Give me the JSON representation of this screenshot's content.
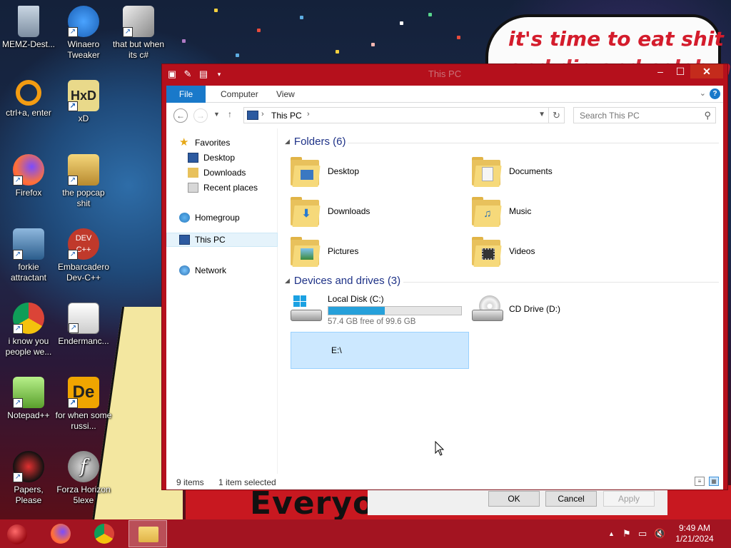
{
  "desktop": {
    "wallpaper_text": "it's time to eat shit",
    "wallpaper_text2": "and die and celebrate",
    "wallpaper_bottom": "Everyo",
    "icons": [
      {
        "label": "MEMZ-Dest...",
        "icon": "recycle-bin-icon"
      },
      {
        "label": "Winaero Tweaker",
        "icon": "winaero-icon"
      },
      {
        "label": "that but when its c#",
        "icon": "stacked-windows-icon"
      },
      {
        "label": "ctrl+a, enter",
        "icon": "ring-icon"
      },
      {
        "label": "xD",
        "icon": "hxd-icon"
      },
      {
        "label": "Firefox",
        "icon": "firefox-icon"
      },
      {
        "label": "the popcap shit",
        "icon": "popcap-icon"
      },
      {
        "label": "forkie attractant",
        "icon": "gears-icon"
      },
      {
        "label": "Embarcadero Dev-C++",
        "icon": "devcpp-icon"
      },
      {
        "label": "i know you people we...",
        "icon": "chrome-icon"
      },
      {
        "label": "Endermanc...",
        "icon": "app-window-icon"
      },
      {
        "label": "Notepad++",
        "icon": "notepadpp-icon"
      },
      {
        "label": "for when some russi...",
        "icon": "de-icon"
      },
      {
        "label": "Papers, Please",
        "icon": "papers-please-icon"
      },
      {
        "label": "Forza Horizon 5lexe",
        "icon": "flash-icon"
      }
    ]
  },
  "behind_dialog": {
    "ok": "OK",
    "cancel": "Cancel",
    "apply": "Apply"
  },
  "window": {
    "title": "This PC",
    "ribbon_tabs": [
      "File",
      "Computer",
      "View"
    ],
    "address": {
      "crumb": "This PC"
    },
    "search": {
      "placeholder": "Search This PC"
    },
    "nav": {
      "favorites": "Favorites",
      "desktop": "Desktop",
      "downloads": "Downloads",
      "recent": "Recent places",
      "homegroup": "Homegroup",
      "this_pc": "This PC",
      "network": "Network"
    },
    "folders_header": "Folders (6)",
    "folders": [
      "Desktop",
      "Documents",
      "Downloads",
      "Music",
      "Pictures",
      "Videos"
    ],
    "drives_header": "Devices and drives (3)",
    "drives": {
      "c": {
        "name": "Local Disk (C:)",
        "free": "57.4 GB free of 99.6 GB",
        "used_fraction": 0.424
      },
      "d": {
        "name": "CD Drive (D:)"
      },
      "e": {
        "name": "E:\\"
      }
    },
    "status": {
      "items": "9 items",
      "selected": "1 item selected"
    }
  },
  "taskbar": {
    "apps": [
      "start-orb-icon",
      "firefox-icon",
      "chrome-icon",
      "file-explorer-icon"
    ],
    "time": "9:49 AM",
    "date": "1/21/2024"
  },
  "colors": {
    "window_frame": "#b5101c",
    "accent": "#1979ca",
    "taskbar": "#a31421"
  }
}
